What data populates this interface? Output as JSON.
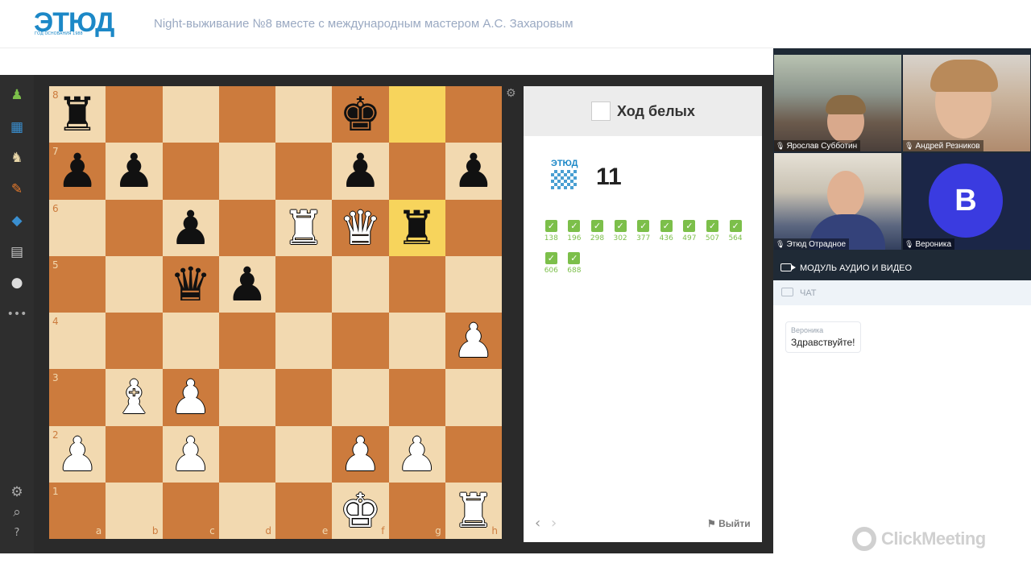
{
  "header": {
    "logo_text": "ЭТЮД",
    "logo_subtitle": "ГОД ОСНОВАНИЯ 1988",
    "title": "Night-выживание №8 вместе с международным мастером А.С. Захаровым"
  },
  "sidebar": {
    "icons": [
      "pawn-icon",
      "puzzle-icon",
      "knight-icon",
      "tools-icon",
      "graduation-cap-icon",
      "calendar-icon",
      "chat-bubbles-icon",
      "more-icon",
      "settings-icon",
      "search-icon",
      "help-icon"
    ]
  },
  "board": {
    "files": [
      "a",
      "b",
      "c",
      "d",
      "e",
      "f",
      "g",
      "h"
    ],
    "ranks": [
      "8",
      "7",
      "6",
      "5",
      "4",
      "3",
      "2",
      "1"
    ],
    "highlight_squares": [
      "g8",
      "g6"
    ],
    "pieces": [
      {
        "square": "a8",
        "glyph": "♜",
        "color": "b"
      },
      {
        "square": "f8",
        "glyph": "♚",
        "color": "b"
      },
      {
        "square": "a7",
        "glyph": "♟",
        "color": "b"
      },
      {
        "square": "b7",
        "glyph": "♟",
        "color": "b"
      },
      {
        "square": "f7",
        "glyph": "♟",
        "color": "b"
      },
      {
        "square": "h7",
        "glyph": "♟",
        "color": "b"
      },
      {
        "square": "c6",
        "glyph": "♟",
        "color": "b"
      },
      {
        "square": "e6",
        "glyph": "♜",
        "color": "w"
      },
      {
        "square": "f6",
        "glyph": "♛",
        "color": "w"
      },
      {
        "square": "g6",
        "glyph": "♜",
        "color": "b"
      },
      {
        "square": "c5",
        "glyph": "♛",
        "color": "b"
      },
      {
        "square": "d5",
        "glyph": "♟",
        "color": "b"
      },
      {
        "square": "h4",
        "glyph": "♟",
        "color": "w"
      },
      {
        "square": "b3",
        "glyph": "♝",
        "color": "w"
      },
      {
        "square": "c3",
        "glyph": "♟",
        "color": "w"
      },
      {
        "square": "a2",
        "glyph": "♟",
        "color": "w"
      },
      {
        "square": "c2",
        "glyph": "♟",
        "color": "w"
      },
      {
        "square": "f2",
        "glyph": "♟",
        "color": "w"
      },
      {
        "square": "g2",
        "glyph": "♟",
        "color": "w"
      },
      {
        "square": "f1",
        "glyph": "♚",
        "color": "w"
      },
      {
        "square": "h1",
        "glyph": "♜",
        "color": "w"
      }
    ]
  },
  "task_panel": {
    "turn_label": "Ход белых",
    "logo_text": "ЭТЮД",
    "task_number": "11",
    "solved": [
      "138",
      "196",
      "298",
      "302",
      "377",
      "436",
      "497",
      "507",
      "564",
      "606",
      "688"
    ],
    "prev_label": "‹",
    "next_label": "›",
    "exit_label": "Выйти"
  },
  "video": {
    "participants": [
      {
        "name": "Ярослав Субботин"
      },
      {
        "name": "Андрей Резников"
      },
      {
        "name": "Этюд Отрадное"
      },
      {
        "name": "Вероника",
        "avatar_letter": "В"
      }
    ],
    "module_label": "МОДУЛЬ АУДИО И ВИДЕО"
  },
  "chat": {
    "label": "ЧАТ",
    "messages": [
      {
        "author": "Вероника",
        "text": "Здравствуйте!"
      }
    ]
  },
  "brand": {
    "text": "ClickMeeting"
  },
  "colors": {
    "logo_blue": "#1c88c7",
    "board_light": "#f2d9b0",
    "board_dark": "#cc7b3d",
    "highlight": "#f7d45c",
    "check_green": "#7cbf4a",
    "avatar_blue": "#3a3be0"
  }
}
